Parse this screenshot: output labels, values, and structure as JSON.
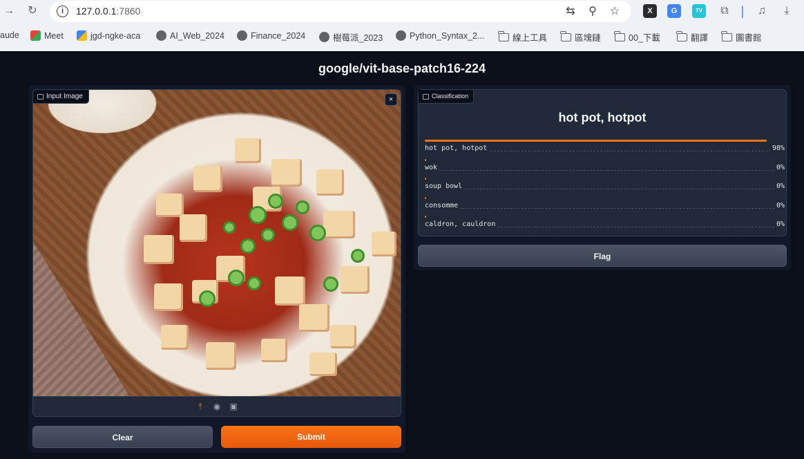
{
  "browser": {
    "url_host": "127.0.0.1",
    "url_port": ":7860",
    "extensions": [
      "X",
      "G",
      "TV"
    ],
    "bookmarks": [
      {
        "label": "aude",
        "icon": "none"
      },
      {
        "label": "Meet",
        "icon": "google-meet-icon"
      },
      {
        "label": "jgd-ngke-aca",
        "icon": "google-meet-icon"
      },
      {
        "label": "AI_Web_2024",
        "icon": "github-icon"
      },
      {
        "label": "Finance_2024",
        "icon": "github-icon"
      },
      {
        "label": "樹莓派_2023",
        "icon": "github-icon"
      },
      {
        "label": "Python_Syntax_2...",
        "icon": "github-icon"
      },
      {
        "label": "線上工具",
        "icon": "folder-icon"
      },
      {
        "label": "區塊鏈",
        "icon": "folder-icon"
      },
      {
        "label": "00_下載",
        "icon": "folder-icon"
      },
      {
        "label": "翻譯",
        "icon": "folder-icon"
      },
      {
        "label": "圖書館",
        "icon": "folder-icon"
      }
    ]
  },
  "app": {
    "title": "google/vit-base-patch16-224",
    "input_label": "Input Image",
    "close_symbol": "×",
    "clear_label": "Clear",
    "submit_label": "Submit",
    "output_label": "Classification",
    "top_label": "hot pot, hotpot",
    "flag_label": "Flag",
    "confidences": [
      {
        "label": "hot pot, hotpot",
        "value": "98%",
        "fraction": 0.98
      },
      {
        "label": "wok",
        "value": "0%",
        "fraction": 0.0
      },
      {
        "label": "soup bowl",
        "value": "0%",
        "fraction": 0.0
      },
      {
        "label": "consomme",
        "value": "0%",
        "fraction": 0.0
      },
      {
        "label": "caldron, cauldron",
        "value": "0%",
        "fraction": 0.0
      }
    ],
    "accent_color": "#f97316"
  }
}
